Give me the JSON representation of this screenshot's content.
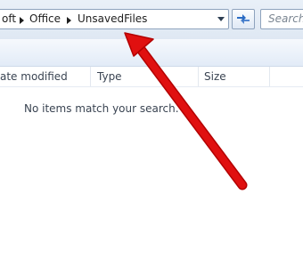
{
  "address_bar": {
    "breadcrumbs": [
      "oft",
      "Office",
      "UnsavedFiles"
    ]
  },
  "search": {
    "placeholder": "Search"
  },
  "columns": [
    "ate modified",
    "Type",
    "Size"
  ],
  "empty_message": "No items match your search.",
  "colors": {
    "arrow": "#e01010",
    "address_border": "#8ea3bd"
  },
  "icons": {
    "separator": "triangle-right",
    "dropdown": "chevron-down",
    "refresh": "refresh-arrows"
  }
}
